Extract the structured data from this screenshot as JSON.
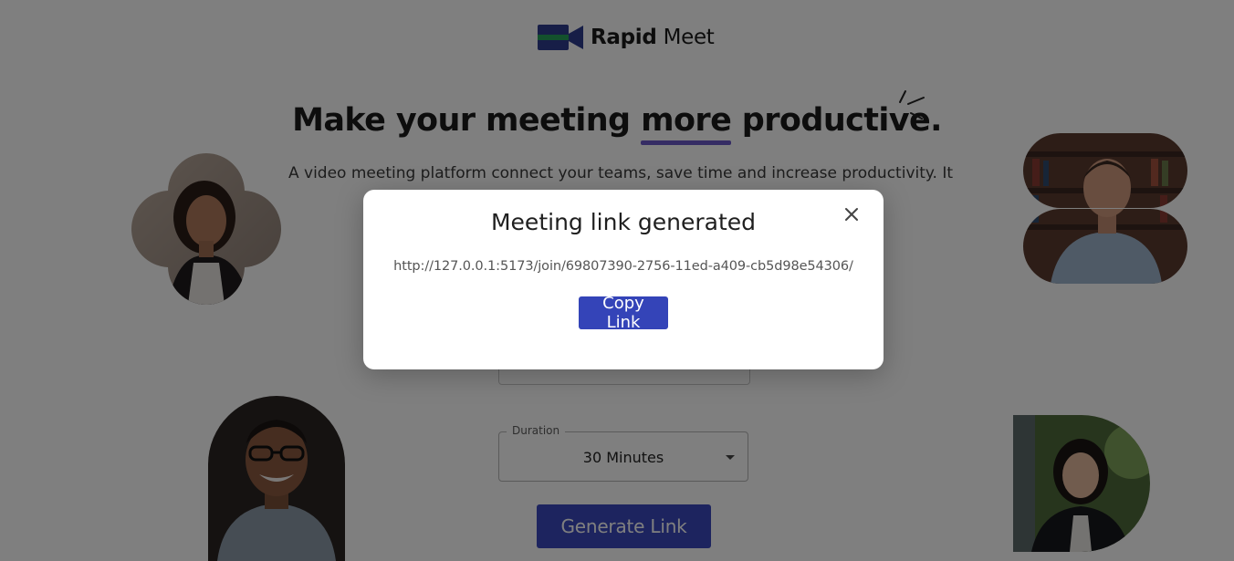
{
  "brand": {
    "name_bold": "Rapid",
    "name_regular": "Meet",
    "colors": {
      "navy": "#2f3c8f",
      "green": "#27a35a"
    }
  },
  "hero": {
    "headline_start": "Make your meeting ",
    "headline_highlight": "more",
    "headline_end": " productive.",
    "subtitle": "A video meeting platform connect your teams, save time and increase productivity. It"
  },
  "avatars": [
    {
      "name": "woman-portrait-flower"
    },
    {
      "name": "man-portrait-bookshelf"
    },
    {
      "name": "man-portrait-glasses"
    },
    {
      "name": "woman-portrait-green"
    }
  ],
  "form": {
    "duration_label": "Duration",
    "duration_value": "30 Minutes",
    "generate_label": "Generate Link"
  },
  "modal": {
    "title": "Meeting link generated",
    "link": "http://127.0.0.1:5173/join/69807390-2756-11ed-a409-cb5d98e54306/",
    "copy_label": "Copy Link",
    "close_icon": "close-icon"
  },
  "colors": {
    "primary_button": "#3444b8",
    "highlight_underline": "#6b58c8"
  }
}
